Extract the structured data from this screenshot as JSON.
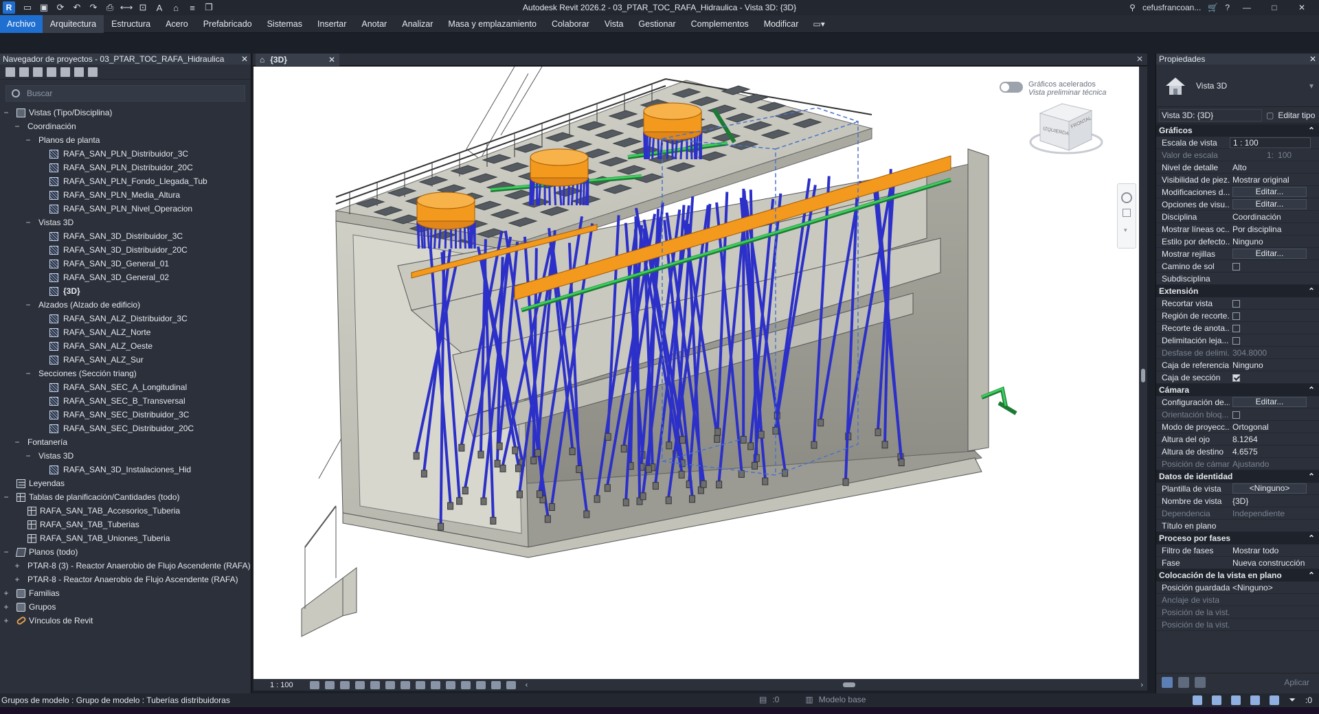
{
  "titlebar": {
    "app_logo": "R",
    "title": "Autodesk Revit 2026.2 - 03_PTAR_TOC_RAFA_Hidraulica - Vista 3D: {3D}",
    "user": "cefusfrancoan...",
    "qat_icons": [
      "open-icon",
      "save-icon",
      "sync-icon",
      "undo-icon",
      "redo-icon",
      "print-icon",
      "measure-icon",
      "align-icon",
      "text-icon",
      "home-icon",
      "thin-lines-icon",
      "switch-windows-icon"
    ]
  },
  "ribbon": {
    "tabs": [
      "Archivo",
      "Arquitectura",
      "Estructura",
      "Acero",
      "Prefabricado",
      "Sistemas",
      "Insertar",
      "Anotar",
      "Analizar",
      "Masa y emplazamiento",
      "Colaborar",
      "Vista",
      "Gestionar",
      "Complementos",
      "Modificar"
    ],
    "active_tab": "Arquitectura"
  },
  "browser": {
    "title": "Navegador de proyectos - 03_PTAR_TOC_RAFA_Hidraulica",
    "search_placeholder": "Buscar",
    "nodes": [
      {
        "label": "Vistas (Tipo/Disciplina)",
        "level": 0,
        "toggle": "−",
        "icon": "views"
      },
      {
        "label": "Coordinación",
        "level": 1,
        "toggle": "−",
        "icon": ""
      },
      {
        "label": "Planos de planta",
        "level": 2,
        "toggle": "−",
        "icon": ""
      },
      {
        "label": "RAFA_SAN_PLN_Distribuidor_3C",
        "level": 3,
        "toggle": "",
        "icon": "view3d"
      },
      {
        "label": "RAFA_SAN_PLN_Distribuidor_20C",
        "level": 3,
        "toggle": "",
        "icon": "view3d"
      },
      {
        "label": "RAFA_SAN_PLN_Fondo_Llegada_Tub",
        "level": 3,
        "toggle": "",
        "icon": "view3d"
      },
      {
        "label": "RAFA_SAN_PLN_Media_Altura",
        "level": 3,
        "toggle": "",
        "icon": "view3d"
      },
      {
        "label": "RAFA_SAN_PLN_Nivel_Operacion",
        "level": 3,
        "toggle": "",
        "icon": "view3d"
      },
      {
        "label": "Vistas 3D",
        "level": 2,
        "toggle": "−",
        "icon": ""
      },
      {
        "label": "RAFA_SAN_3D_Distribuidor_3C",
        "level": 3,
        "toggle": "",
        "icon": "view3d"
      },
      {
        "label": "RAFA_SAN_3D_Distribuidor_20C",
        "level": 3,
        "toggle": "",
        "icon": "view3d"
      },
      {
        "label": "RAFA_SAN_3D_General_01",
        "level": 3,
        "toggle": "",
        "icon": "view3d"
      },
      {
        "label": "RAFA_SAN_3D_General_02",
        "level": 3,
        "toggle": "",
        "icon": "view3d"
      },
      {
        "label": "{3D}",
        "level": 3,
        "toggle": "",
        "icon": "view3d",
        "bold": true
      },
      {
        "label": "Alzados (Alzado de edificio)",
        "level": 2,
        "toggle": "−",
        "icon": ""
      },
      {
        "label": "RAFA_SAN_ALZ_Distribuidor_3C",
        "level": 3,
        "toggle": "",
        "icon": "view3d"
      },
      {
        "label": "RAFA_SAN_ALZ_Norte",
        "level": 3,
        "toggle": "",
        "icon": "view3d"
      },
      {
        "label": "RAFA_SAN_ALZ_Oeste",
        "level": 3,
        "toggle": "",
        "icon": "view3d"
      },
      {
        "label": "RAFA_SAN_ALZ_Sur",
        "level": 3,
        "toggle": "",
        "icon": "view3d"
      },
      {
        "label": "Secciones (Sección triang)",
        "level": 2,
        "toggle": "−",
        "icon": ""
      },
      {
        "label": "RAFA_SAN_SEC_A_Longitudinal",
        "level": 3,
        "toggle": "",
        "icon": "view3d"
      },
      {
        "label": "RAFA_SAN_SEC_B_Transversal",
        "level": 3,
        "toggle": "",
        "icon": "view3d"
      },
      {
        "label": "RAFA_SAN_SEC_Distribuidor_3C",
        "level": 3,
        "toggle": "",
        "icon": "view3d"
      },
      {
        "label": "RAFA_SAN_SEC_Distribuidor_20C",
        "level": 3,
        "toggle": "",
        "icon": "view3d"
      },
      {
        "label": "Fontanería",
        "level": 1,
        "toggle": "−",
        "icon": ""
      },
      {
        "label": "Vistas 3D",
        "level": 2,
        "toggle": "−",
        "icon": ""
      },
      {
        "label": "RAFA_SAN_3D_Instalaciones_Hid",
        "level": 3,
        "toggle": "",
        "icon": "view3d"
      },
      {
        "label": "Leyendas",
        "level": 0,
        "toggle": "",
        "icon": "legend"
      },
      {
        "label": "Tablas de planificación/Cantidades (todo)",
        "level": 0,
        "toggle": "−",
        "icon": "table"
      },
      {
        "label": "RAFA_SAN_TAB_Accesorios_Tuberia",
        "level": 1,
        "toggle": "",
        "icon": "table"
      },
      {
        "label": "RAFA_SAN_TAB_Tuberias",
        "level": 1,
        "toggle": "",
        "icon": "table"
      },
      {
        "label": "RAFA_SAN_TAB_Uniones_Tuberia",
        "level": 1,
        "toggle": "",
        "icon": "table"
      },
      {
        "label": "Planos (todo)",
        "level": 0,
        "toggle": "−",
        "icon": "sheet"
      },
      {
        "label": "PTAR-8 (3) - Reactor Anaerobio de Flujo Ascendente (RAFA)",
        "level": 1,
        "toggle": "+",
        "icon": ""
      },
      {
        "label": "PTAR-8 - Reactor Anaerobio de Flujo Ascendente (RAFA)",
        "level": 1,
        "toggle": "+",
        "icon": ""
      },
      {
        "label": "Familias",
        "level": 0,
        "toggle": "+",
        "icon": "family"
      },
      {
        "label": "Grupos",
        "level": 0,
        "toggle": "+",
        "icon": "family"
      },
      {
        "label": "Vínculos de Revit",
        "level": 0,
        "toggle": "+",
        "icon": "link"
      }
    ]
  },
  "view": {
    "tab_label": "{3D}",
    "scale": "1 : 100",
    "nav": {
      "toggle_label": "Gráficos acelerados",
      "toggle_sub": "Vista preliminar técnica"
    },
    "viewcube": {
      "left": "IZQUIERDA",
      "front": "FRONTAL"
    }
  },
  "properties": {
    "title": "Propiedades",
    "type_name": "Vista 3D",
    "type_selector": "Vista 3D: {3D}",
    "edit_type": "Editar tipo",
    "apply": "Aplicar",
    "groups": [
      {
        "name": "Gráficos",
        "rows": [
          {
            "k": "Escala de vista",
            "v": "1 : 100",
            "kind": "input"
          },
          {
            "k": "Valor de escala",
            "v": "100",
            "kind": "dim",
            "sep": "1:"
          },
          {
            "k": "Nivel de detalle",
            "v": "Alto",
            "kind": "text"
          },
          {
            "k": "Visibilidad de piez...",
            "v": "Mostrar original",
            "kind": "text"
          },
          {
            "k": "Modificaciones d...",
            "v": "Editar...",
            "kind": "button"
          },
          {
            "k": "Opciones de visu...",
            "v": "Editar...",
            "kind": "button"
          },
          {
            "k": "Disciplina",
            "v": "Coordinación",
            "kind": "text"
          },
          {
            "k": "Mostrar líneas oc...",
            "v": "Por disciplina",
            "kind": "text"
          },
          {
            "k": "Estilo por defecto...",
            "v": "Ninguno",
            "kind": "text"
          },
          {
            "k": "Mostrar rejillas",
            "v": "Editar...",
            "kind": "button"
          },
          {
            "k": "Camino de sol",
            "v": "",
            "kind": "check"
          },
          {
            "k": "Subdisciplina",
            "v": "",
            "kind": "text"
          }
        ]
      },
      {
        "name": "Extensión",
        "rows": [
          {
            "k": "Recortar vista",
            "v": "",
            "kind": "check"
          },
          {
            "k": "Región de recorte...",
            "v": "",
            "kind": "check"
          },
          {
            "k": "Recorte de anota...",
            "v": "",
            "kind": "check"
          },
          {
            "k": "Delimitación leja...",
            "v": "",
            "kind": "check"
          },
          {
            "k": "Desfase de delimi...",
            "v": "304.8000",
            "kind": "dim"
          },
          {
            "k": "Caja de referencia",
            "v": "Ninguno",
            "kind": "text"
          },
          {
            "k": "Caja de sección",
            "v": "",
            "kind": "check-on"
          }
        ]
      },
      {
        "name": "Cámara",
        "rows": [
          {
            "k": "Configuración de...",
            "v": "Editar...",
            "kind": "button"
          },
          {
            "k": "Orientación bloq...",
            "v": "",
            "kind": "check-dim"
          },
          {
            "k": "Modo de proyecc...",
            "v": "Ortogonal",
            "kind": "text"
          },
          {
            "k": "Altura del ojo",
            "v": "8.1264",
            "kind": "text"
          },
          {
            "k": "Altura de destino",
            "v": "4.6575",
            "kind": "text"
          },
          {
            "k": "Posición de cámara",
            "v": "Ajustando",
            "kind": "dim"
          }
        ]
      },
      {
        "name": "Datos de identidad",
        "rows": [
          {
            "k": "Plantilla de vista",
            "v": "<Ninguno>",
            "kind": "button"
          },
          {
            "k": "Nombre de vista",
            "v": "{3D}",
            "kind": "text"
          },
          {
            "k": "Dependencia",
            "v": "Independiente",
            "kind": "dim"
          },
          {
            "k": "Título en plano",
            "v": "",
            "kind": "text"
          }
        ]
      },
      {
        "name": "Proceso por fases",
        "rows": [
          {
            "k": "Filtro de fases",
            "v": "Mostrar todo",
            "kind": "text"
          },
          {
            "k": "Fase",
            "v": "Nueva construcción",
            "kind": "text"
          }
        ]
      },
      {
        "name": "Colocación de la vista en plano",
        "rows": [
          {
            "k": "Posición guardada",
            "v": "<Ninguno>",
            "kind": "text"
          },
          {
            "k": "Anclaje de vista",
            "v": "",
            "kind": "dim"
          },
          {
            "k": "Posición de la vist...",
            "v": "",
            "kind": "dim"
          },
          {
            "k": "Posición de la vist...",
            "v": "",
            "kind": "dim"
          }
        ]
      }
    ]
  },
  "status": {
    "message": "Grupos de modelo : Grupo de modelo : Tuberías distribuidoras",
    "workset_count": ":0",
    "model": "Modelo base",
    "filter_count": ":0"
  },
  "colors": {
    "accent": "#1f6fd1",
    "concrete": "#cfcfc6",
    "pipe_blue": "#2c30c8",
    "pipe_green": "#2ea84a",
    "orange": "#f39a1e"
  }
}
